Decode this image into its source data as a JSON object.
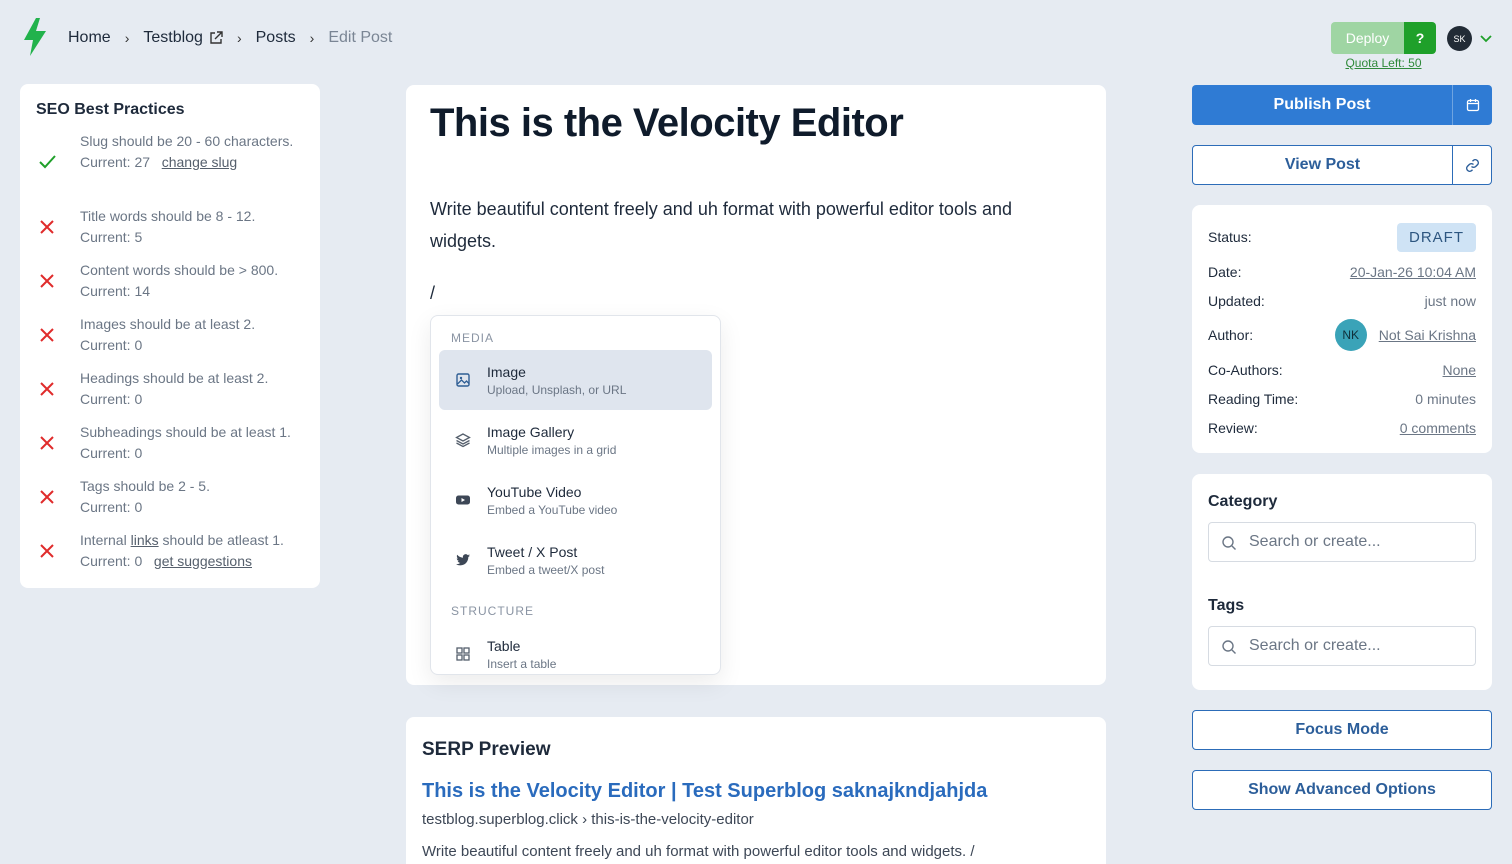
{
  "breadcrumb": {
    "home": "Home",
    "blog": "Testblog",
    "posts": "Posts",
    "current": "Edit Post"
  },
  "deploy": {
    "label": "Deploy",
    "help": "?",
    "quota": "Quota Left: 50"
  },
  "user": {
    "initials": "SK"
  },
  "seo": {
    "title": "SEO Best Practices",
    "items": [
      {
        "status": "pass",
        "text": "Slug should be 20 - 60 characters.",
        "current": "Current: 27",
        "action": "change slug"
      },
      {
        "status": "fail",
        "text": "Title words should be 8 - 12.",
        "current": "Current: 5"
      },
      {
        "status": "fail",
        "text": "Content words should be > 800.",
        "current": "Current: 14"
      },
      {
        "status": "fail",
        "text": "Images should be at least 2.",
        "current": "Current: 0"
      },
      {
        "status": "fail",
        "text": "Headings should be at least 2.",
        "current": "Current: 0"
      },
      {
        "status": "fail",
        "text": "Subheadings should be at least 1.",
        "current": "Current: 0"
      },
      {
        "status": "fail",
        "text": "Tags should be 2 - 5.",
        "current": "Current: 0"
      },
      {
        "status": "fail",
        "text_pre": "Internal ",
        "text_link": "links",
        "text_post": " should be atleast 1.",
        "current": "Current: 0",
        "action": "get suggestions"
      }
    ]
  },
  "editor": {
    "title": "This is the Velocity Editor",
    "body": "Write beautiful content freely and uh format with powerful editor tools and widgets.",
    "slash": "/"
  },
  "slash_menu": {
    "media_label": "MEDIA",
    "structure_label": "STRUCTURE",
    "items": [
      {
        "icon": "image-icon",
        "title": "Image",
        "desc": "Upload, Unsplash, or URL"
      },
      {
        "icon": "layers-icon",
        "title": "Image Gallery",
        "desc": "Multiple images in a grid"
      },
      {
        "icon": "youtube-icon",
        "title": "YouTube Video",
        "desc": "Embed a YouTube video"
      },
      {
        "icon": "twitter-icon",
        "title": "Tweet / X Post",
        "desc": "Embed a tweet/X post"
      },
      {
        "icon": "table-icon",
        "title": "Table",
        "desc": "Insert a table"
      }
    ]
  },
  "serp": {
    "heading": "SERP Preview",
    "title": "This is the Velocity Editor | Test Superblog saknajkndjahjda",
    "url": "testblog.superblog.click › this-is-the-velocity-editor",
    "desc": "Write beautiful content freely and uh format with powerful editor tools and widgets. /"
  },
  "actions": {
    "publish": "Publish Post",
    "view": "View Post",
    "focus": "Focus Mode",
    "advanced": "Show Advanced Options"
  },
  "meta": {
    "status_label": "Status:",
    "status": "DRAFT",
    "date_label": "Date:",
    "date": "20-Jan-26 10:04 AM",
    "updated_label": "Updated:",
    "updated": "just now",
    "author_label": "Author:",
    "author_initials": "NK",
    "author": "Not Sai Krishna",
    "coauthors_label": "Co-Authors:",
    "coauthors": "None",
    "reading_label": "Reading Time:",
    "reading": "0 minutes",
    "review_label": "Review:",
    "review": "0 comments"
  },
  "taxonomy": {
    "category_label": "Category",
    "category_placeholder": "Search or create...",
    "tags_label": "Tags",
    "tags_placeholder": "Search or create..."
  },
  "colors": {
    "accent": "#2f7bd4",
    "pass": "#1fa02a",
    "fail": "#e02b2b",
    "logo": "#22b24c"
  }
}
